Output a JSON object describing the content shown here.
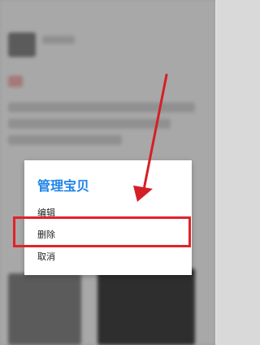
{
  "dialog": {
    "title": "管理宝贝",
    "items": [
      {
        "label": "编辑"
      },
      {
        "label": "删除"
      },
      {
        "label": "取消"
      }
    ]
  },
  "colors": {
    "title": "#1f84e8",
    "highlight": "#e0232a",
    "arrow": "#e0232a"
  }
}
